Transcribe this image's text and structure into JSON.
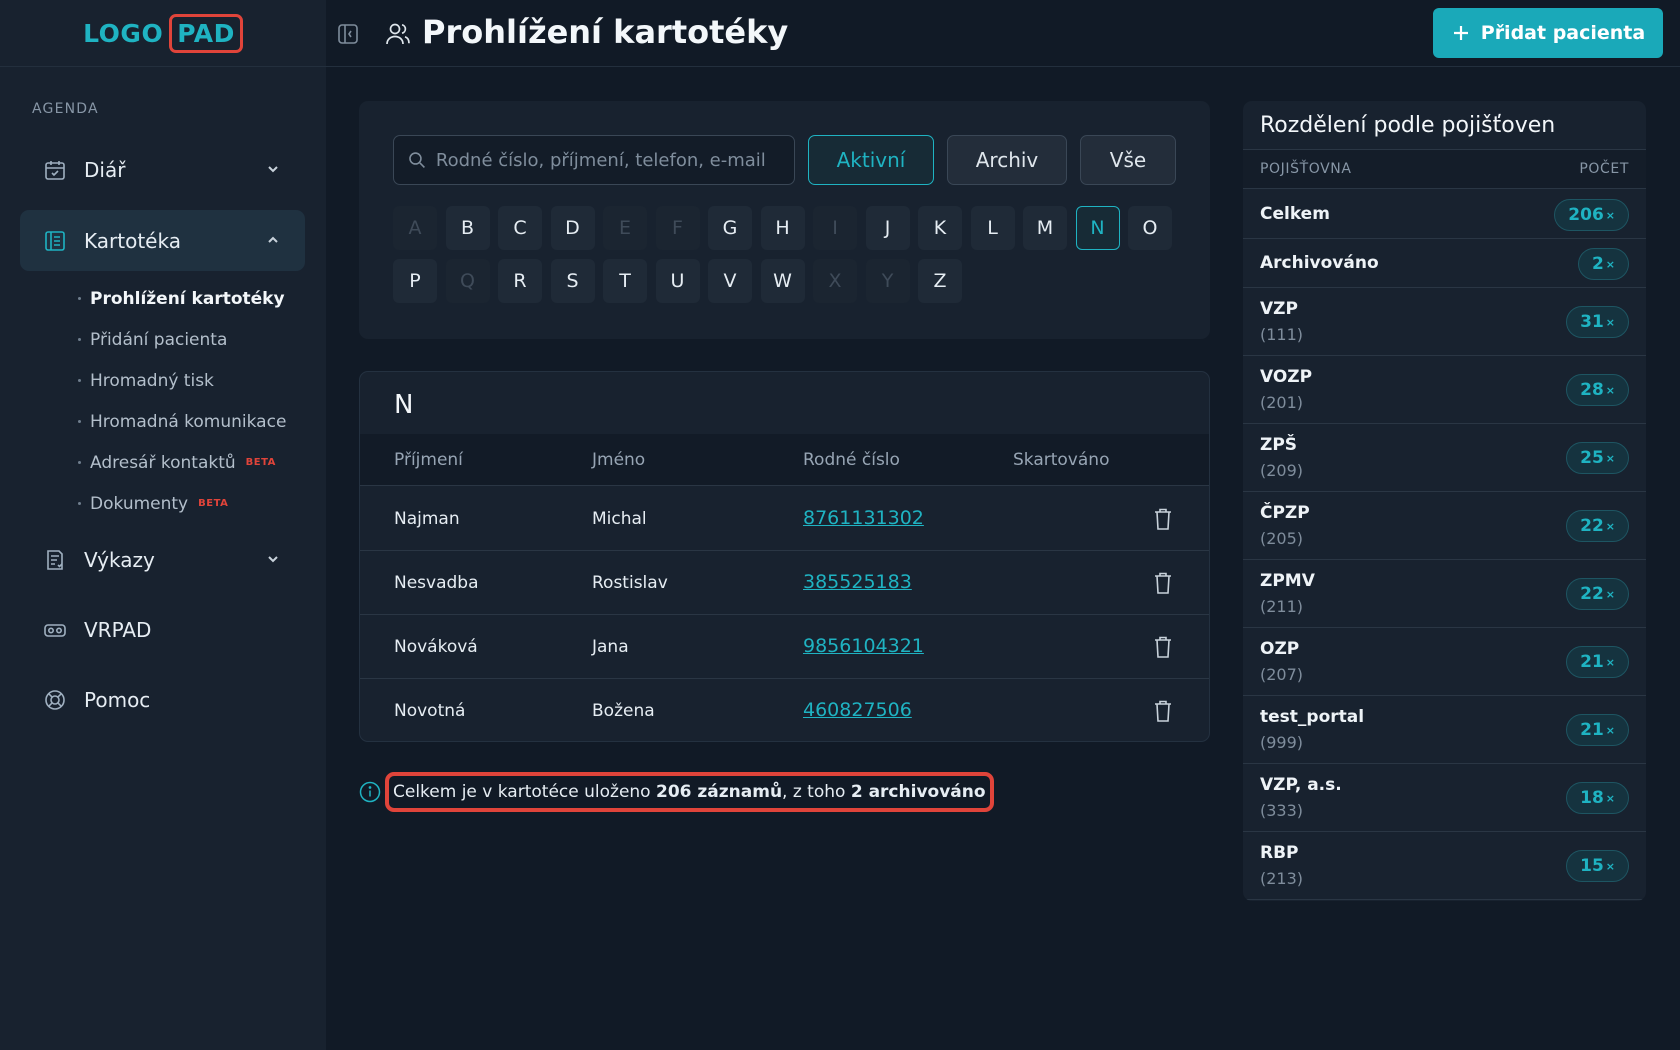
{
  "logo": {
    "part1": "LOGO",
    "part2": "PAD"
  },
  "sidebar": {
    "section_label": "AGENDA",
    "items": [
      {
        "label": "Diář",
        "icon": "calendar-icon"
      },
      {
        "label": "Kartotéka",
        "icon": "address-book-icon"
      },
      {
        "label": "Výkazy",
        "icon": "report-icon"
      },
      {
        "label": "VRPAD",
        "icon": "vr-headset-icon"
      },
      {
        "label": "Pomoc",
        "icon": "lifebuoy-icon"
      }
    ],
    "submenu": [
      {
        "label": "Prohlížení kartotéky"
      },
      {
        "label": "Přidání pacienta"
      },
      {
        "label": "Hromadný tisk"
      },
      {
        "label": "Hromadná komunikace"
      },
      {
        "label": "Adresář kontaktů",
        "badge": "BETA"
      },
      {
        "label": "Dokumenty",
        "badge": "BETA"
      }
    ]
  },
  "header": {
    "title": "Prohlížení kartotéky",
    "add_button": "Přidat pacienta"
  },
  "search": {
    "placeholder": "Rodné číslo, příjmení, telefon, e-mail",
    "filters": [
      "Aktivní",
      "Archiv",
      "Vše"
    ],
    "active_filter": "Aktivní"
  },
  "letters": {
    "row1": [
      "A",
      "B",
      "C",
      "D",
      "E",
      "F",
      "G",
      "H",
      "I",
      "J",
      "K",
      "L",
      "M",
      "N",
      "O"
    ],
    "row2": [
      "P",
      "Q",
      "R",
      "S",
      "T",
      "U",
      "V",
      "W",
      "X",
      "Y",
      "Z"
    ],
    "disabled": [
      "A",
      "E",
      "F",
      "I",
      "Q",
      "X",
      "Y"
    ],
    "selected": "N"
  },
  "table": {
    "group_letter": "N",
    "columns": [
      "Příjmení",
      "Jméno",
      "Rodné číslo",
      "Skartováno"
    ],
    "rows": [
      {
        "surname": "Najman",
        "name": "Michal",
        "birth_number": "8761131302"
      },
      {
        "surname": "Nesvadba",
        "name": "Rostislav",
        "birth_number": "385525183"
      },
      {
        "surname": "Nováková",
        "name": "Jana",
        "birth_number": "9856104321"
      },
      {
        "surname": "Novotná",
        "name": "Božena",
        "birth_number": "460827506"
      }
    ]
  },
  "info": {
    "prefix": "Celkem je v kartotéce uloženo ",
    "total": "206 záznamů",
    "middle": ", z toho ",
    "archived": "2 archivováno"
  },
  "insurance": {
    "title": "Rozdělení podle pojišťoven",
    "col_name": "POJIŠŤOVNA",
    "col_count": "POČET",
    "count_suffix": "×",
    "rows": [
      {
        "name": "Celkem",
        "code": "",
        "count": "206"
      },
      {
        "name": "Archivováno",
        "code": "",
        "count": "2"
      },
      {
        "name": "VZP",
        "code": "(111)",
        "count": "31"
      },
      {
        "name": "VOZP",
        "code": "(201)",
        "count": "28"
      },
      {
        "name": "ZPŠ",
        "code": "(209)",
        "count": "25"
      },
      {
        "name": "ČPZP",
        "code": "(205)",
        "count": "22"
      },
      {
        "name": "ZPMV",
        "code": "(211)",
        "count": "22"
      },
      {
        "name": "OZP",
        "code": "(207)",
        "count": "21"
      },
      {
        "name": "test_portal",
        "code": "(999)",
        "count": "21"
      },
      {
        "name": "VZP, a.s.",
        "code": "(333)",
        "count": "18"
      },
      {
        "name": "RBP",
        "code": "(213)",
        "count": "15"
      }
    ]
  },
  "colors": {
    "accent": "#1fb3c2",
    "highlight_border": "#e0443a",
    "background": "#111a26",
    "panel": "#18222f"
  }
}
